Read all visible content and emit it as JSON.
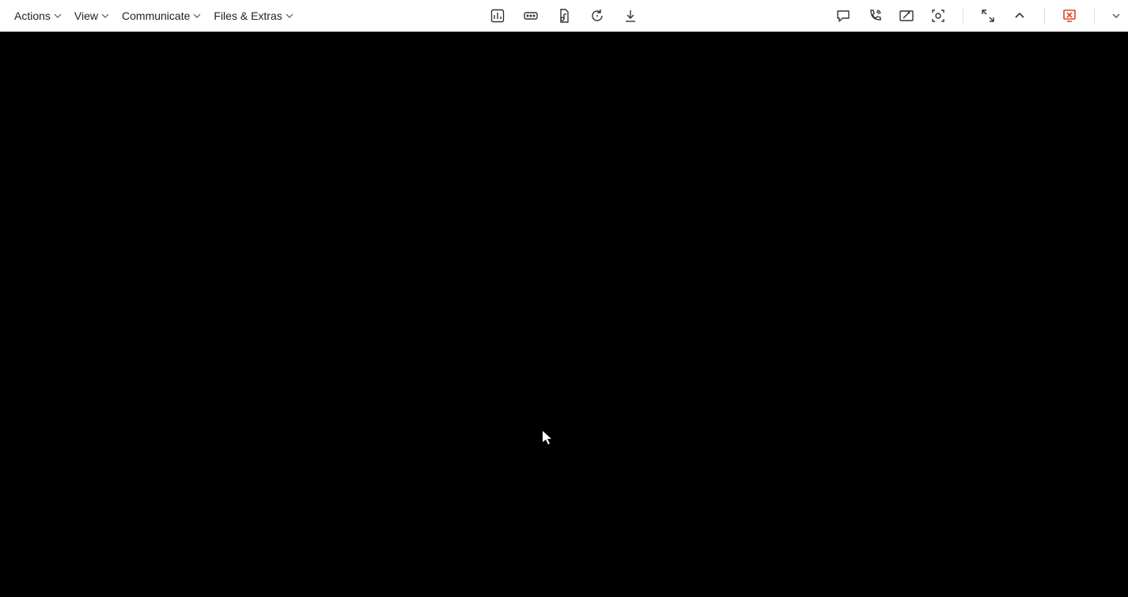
{
  "menubar": {
    "actions": "Actions",
    "view": "View",
    "communicate": "Communicate",
    "files_extras": "Files & Extras"
  },
  "center_tools": {
    "dashboard": "dashboard-icon",
    "remote_input": "remote-input-icon",
    "audio_file": "audio-file-icon",
    "restart": "restart-icon",
    "download": "download-icon"
  },
  "right_tools": {
    "chat": "chat-icon",
    "call": "call-icon",
    "annotate": "annotate-icon",
    "screenshot": "screenshot-icon",
    "fullscreen": "fullscreen-icon",
    "minimize": "minimize-icon",
    "close": "close-session-icon",
    "options": "options-icon"
  }
}
